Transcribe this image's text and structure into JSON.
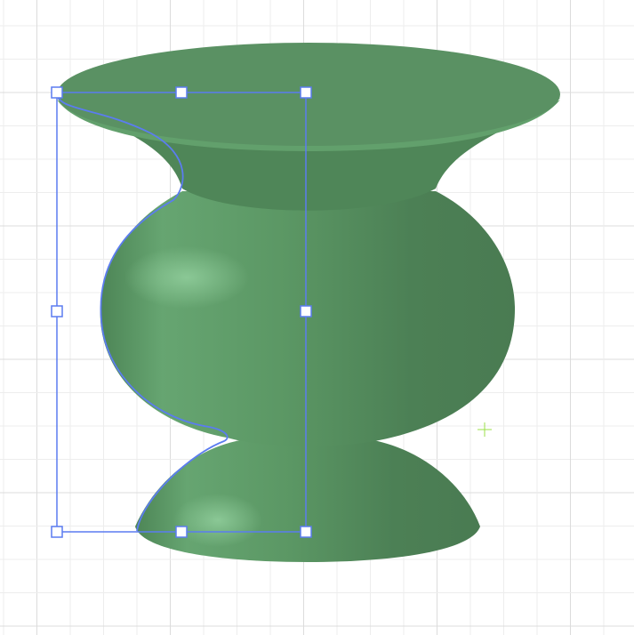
{
  "viewport": {
    "object": "vase-revolve-surface",
    "colors": {
      "grid_minor": "#ededed",
      "grid_major": "#dcdcdc",
      "surface": "#5a9163",
      "surface_dark": "#4a7d54",
      "surface_light": "#7cbf88",
      "selection": "#5b7cf0",
      "cursor": "#9be04a"
    }
  }
}
